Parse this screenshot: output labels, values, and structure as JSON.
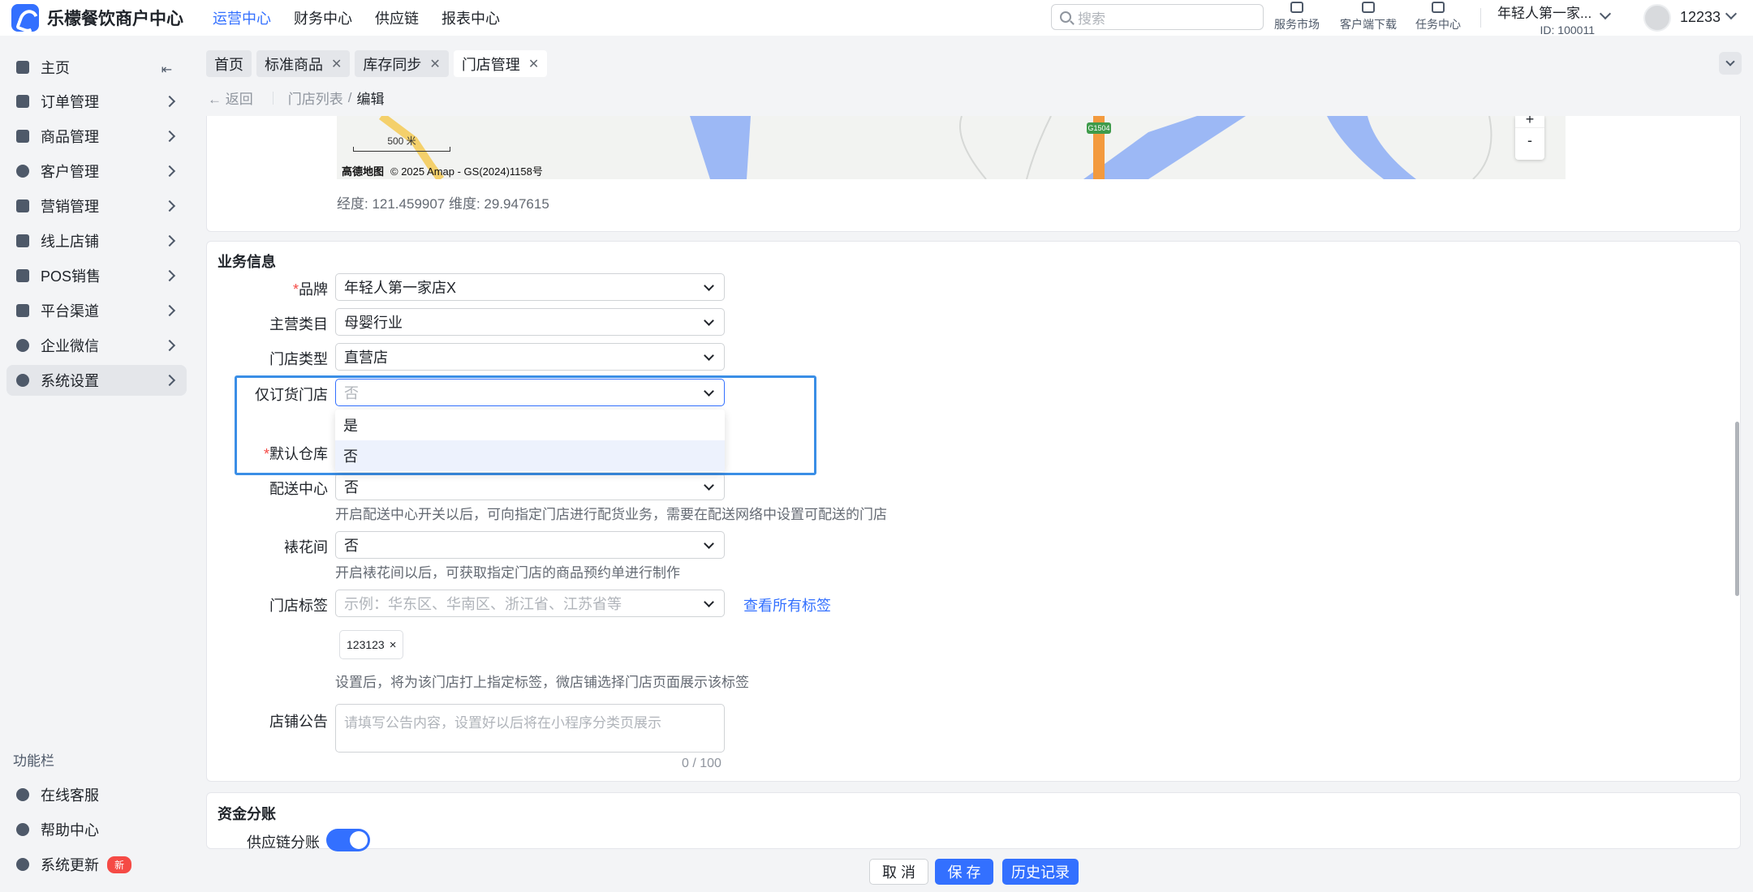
{
  "brand": {
    "name": "乐檬餐饮商户中心"
  },
  "topnav": [
    "运营中心",
    "财务中心",
    "供应链",
    "报表中心"
  ],
  "search": {
    "placeholder": "搜索"
  },
  "tools": [
    "服务市场",
    "客户端下载",
    "任务中心"
  ],
  "merchant": {
    "name": "年轻人第一家...",
    "id": "ID: 100011"
  },
  "user": {
    "name": "12233"
  },
  "sidebar": {
    "items": [
      "主页",
      "订单管理",
      "商品管理",
      "客户管理",
      "营销管理",
      "线上店铺",
      "POS销售",
      "平台渠道",
      "企业微信",
      "系统设置"
    ],
    "function_title": "功能栏",
    "functions": [
      "在线客服",
      "帮助中心",
      "系统更新"
    ],
    "new_badge": "新"
  },
  "tabs": [
    "首页",
    "标准商品",
    "库存同步",
    "门店管理"
  ],
  "breadcrumb": {
    "back": "返回",
    "list": "门店列表",
    "sep": "/",
    "current": "编辑"
  },
  "map": {
    "scale": "500 米",
    "attribution_logo": "高德地图",
    "attribution": "© 2025 Amap - GS(2024)1158号",
    "road_label": "G1504",
    "zoom_in": "+",
    "zoom_out": "-",
    "coords": "经度: 121.459907  维度: 29.947615"
  },
  "business": {
    "title": "业务信息",
    "brand_label": "品牌",
    "brand_value": "年轻人第一家店X",
    "category_label": "主营类目",
    "category_value": "母婴行业",
    "storetype_label": "门店类型",
    "storetype_value": "直营店",
    "orderonly_label": "仅订货门店",
    "orderonly_placeholder": "否",
    "options": [
      "是",
      "否"
    ],
    "warehouse_label": "默认仓库",
    "dist_label": "配送中心",
    "dist_value": "否",
    "dist_hint": "开启配送中心开关以后，可向指定门店进行配货业务，需要在配送网络中设置可配送的门店",
    "flower_label": "裱花间",
    "flower_value": "否",
    "flower_hint": "开启裱花间以后，可获取指定门店的商品预约单进行制作",
    "tags_label": "门店标签",
    "tags_placeholder": "示例：华东区、华南区、浙江省、江苏省等",
    "tags_link": "查看所有标签",
    "tag_chip": "123123",
    "tag_chip_close": "×",
    "tags_hint": "设置后，将为该门店打上指定标签，微店铺选择门店页面展示该标签",
    "notice_label": "店铺公告",
    "notice_placeholder": "请填写公告内容，设置好以后将在小程序分类页展示",
    "notice_counter": "0 / 100"
  },
  "funds": {
    "title": "资金分账",
    "supply_label": "供应链分账",
    "supply_enabled": true
  },
  "footer": {
    "cancel": "取 消",
    "save": "保 存",
    "history": "历史记录"
  }
}
